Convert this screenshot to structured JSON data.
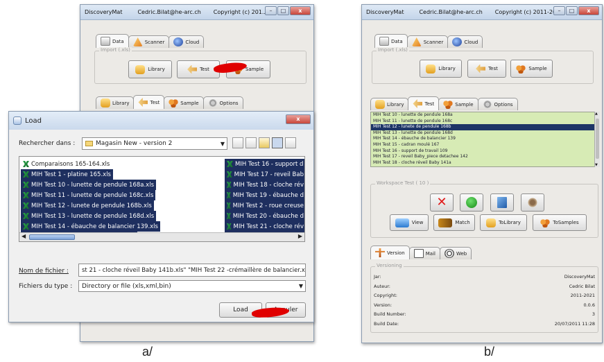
{
  "captions": {
    "a": "a/",
    "b": "b/"
  },
  "window_a": {
    "app": "DiscoveryMat",
    "email": "Cedric.Bilat@he-arc.ch",
    "copyright": "Copyright (c) 201...",
    "main_tabs": [
      "Data",
      "Scanner",
      "Cloud"
    ],
    "import_title": "Import (.xls)",
    "import_buttons": [
      "Library",
      "Test",
      "Sample"
    ],
    "sub_tabs": [
      "Library",
      "Test",
      "Sample",
      "Options"
    ]
  },
  "load_dialog": {
    "title": "Load",
    "look_in_label": "Rechercher dans :",
    "look_in_value": "Magasin New - version 2",
    "files_left": [
      {
        "name": "Comparaisons 165-164.xls",
        "selected": false
      },
      {
        "name": "MIH Test 1 - platine 165.xls",
        "selected": true
      },
      {
        "name": "MIH Test 10 - lunette de pendule 168a.xls",
        "selected": true
      },
      {
        "name": "MIH Test 11 - lunette de pendule 168c.xls",
        "selected": true
      },
      {
        "name": "MIH Test 12 - lunete de pendule 168b.xls",
        "selected": true
      },
      {
        "name": "MIH Test 13 - lunette de pendule 168d.xls",
        "selected": true
      },
      {
        "name": "MIH Test 14 - ébauche de balancier 139.xls",
        "selected": true
      },
      {
        "name": "MIH Test 15 - cadran moulé 167.xls",
        "selected": true
      }
    ],
    "files_right": [
      {
        "name": "MIH Test 16 - support d",
        "selected": true
      },
      {
        "name": "MIH Test 17 - reveil Bab",
        "selected": true
      },
      {
        "name": "MIH Test 18 - cloche rév",
        "selected": true
      },
      {
        "name": "MIH Test 19 - ébauche d",
        "selected": true
      },
      {
        "name": "MIH Test 2 - roue creuse",
        "selected": true
      },
      {
        "name": "MIH Test 20 - ébauche d",
        "selected": true
      },
      {
        "name": "MIH Test 21 - cloche rév",
        "selected": true
      },
      {
        "name": "MIH Test 22 -crémaillère",
        "selected": true
      }
    ],
    "filename_label": "Nom de fichier :",
    "filename_value": "st 21 - cloche réveil Baby 141b.xls\" \"MIH Test 22 -crémaillère de balancier.xls\"",
    "filetype_label": "Fichiers du type :",
    "filetype_value": "Directory or file (xls,xml,bin)",
    "load_button": "Load",
    "cancel_button": "Annuler"
  },
  "window_b": {
    "app": "DiscoveryMat",
    "email": "Cedric.Bilat@he-arc.ch",
    "copyright": "Copyright (c) 2011-2021",
    "main_tabs": [
      "Data",
      "Scanner",
      "Cloud"
    ],
    "import_title": "Import (.xls)",
    "import_buttons": [
      "Library",
      "Test",
      "Sample"
    ],
    "sub_tabs": [
      "Library",
      "Test",
      "Sample",
      "Options"
    ],
    "tests": [
      "MIH Test 10 - lunette de pendule 168a",
      "MIH Test 11 - lunette de pendule 168c",
      "MIH Test 12 - lunete de pendule 168b",
      "MIH Test 13 - lunette de pendule 168d",
      "MIH Test 14 - ébauche de balancier 139",
      "MIH Test 15 - cadran moulé 167",
      "MIH Test 16 - support de travail 109",
      "MIH Test 17 - reveil Baby_piece detachee 142",
      "MIH Test 18 - cloche réveil Baby 141a"
    ],
    "selected_test_index": 2,
    "workspace_title": "Workspace Test ( 10 )",
    "action_buttons": [
      "View",
      "Match",
      "ToLibrary",
      "ToSamples"
    ],
    "bottom_tabs": [
      "Version",
      "Mail",
      "Web"
    ],
    "versioning_title": "Versioning",
    "versioning": [
      {
        "k": "Jar:",
        "v": "DiscoveryMat"
      },
      {
        "k": "Auteur:",
        "v": "Cedric Bilat"
      },
      {
        "k": "Copyright:",
        "v": "2011-2021"
      },
      {
        "k": "Version:",
        "v": "0.0.6"
      },
      {
        "k": "Build Number:",
        "v": "3"
      },
      {
        "k": "Build Date:",
        "v": "20/07/2011 11:28"
      }
    ]
  }
}
